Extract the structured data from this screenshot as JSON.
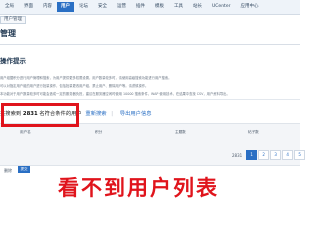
{
  "nav": {
    "tabs": [
      "全局",
      "界面",
      "内容",
      "用户",
      "论坛",
      "安全",
      "运营",
      "插件",
      "模板",
      "工具",
      "站长",
      "UCenter",
      "应用中心"
    ],
    "active_index": 3
  },
  "breadcrumb": {
    "current": "用户管理"
  },
  "page": {
    "title": "管理"
  },
  "tips": {
    "title": "操作提示",
    "lines": [
      "用户组据积分进行用户管理和搜索，为用户提供更多权限设置，用户数量较多时，请使用高级搜索功能进行用户搜索。",
      "可以对指定用户组的用户进行批量操作，包括批量更改用户组、禁止用户、删除用户等。请谨慎操作。",
      "本功能对于用户数量较多时可能会造成一定的服务器负担，建议在服务器空闲时使用 10000 搜索条件，WAP 使用技术，在结果中查找 CSV，用户资料导出。"
    ]
  },
  "results": {
    "prefix": "共搜索到",
    "count": "2831",
    "suffix": "名符合条件的用户",
    "link_research": "重新搜索",
    "link_export": "导出用户信息"
  },
  "table": {
    "headers": [
      "用户名",
      "积分",
      "主题数",
      "帖子数"
    ]
  },
  "pagination": {
    "total": "2831",
    "pages": [
      "1",
      "2",
      "3",
      "4",
      "5"
    ],
    "current_index": 0
  },
  "bottom": {
    "label": "删除",
    "button": "提交"
  },
  "caption": "看不到用户列表",
  "colors": {
    "accent": "#2a6fc4",
    "annotation": "#e0141c"
  }
}
